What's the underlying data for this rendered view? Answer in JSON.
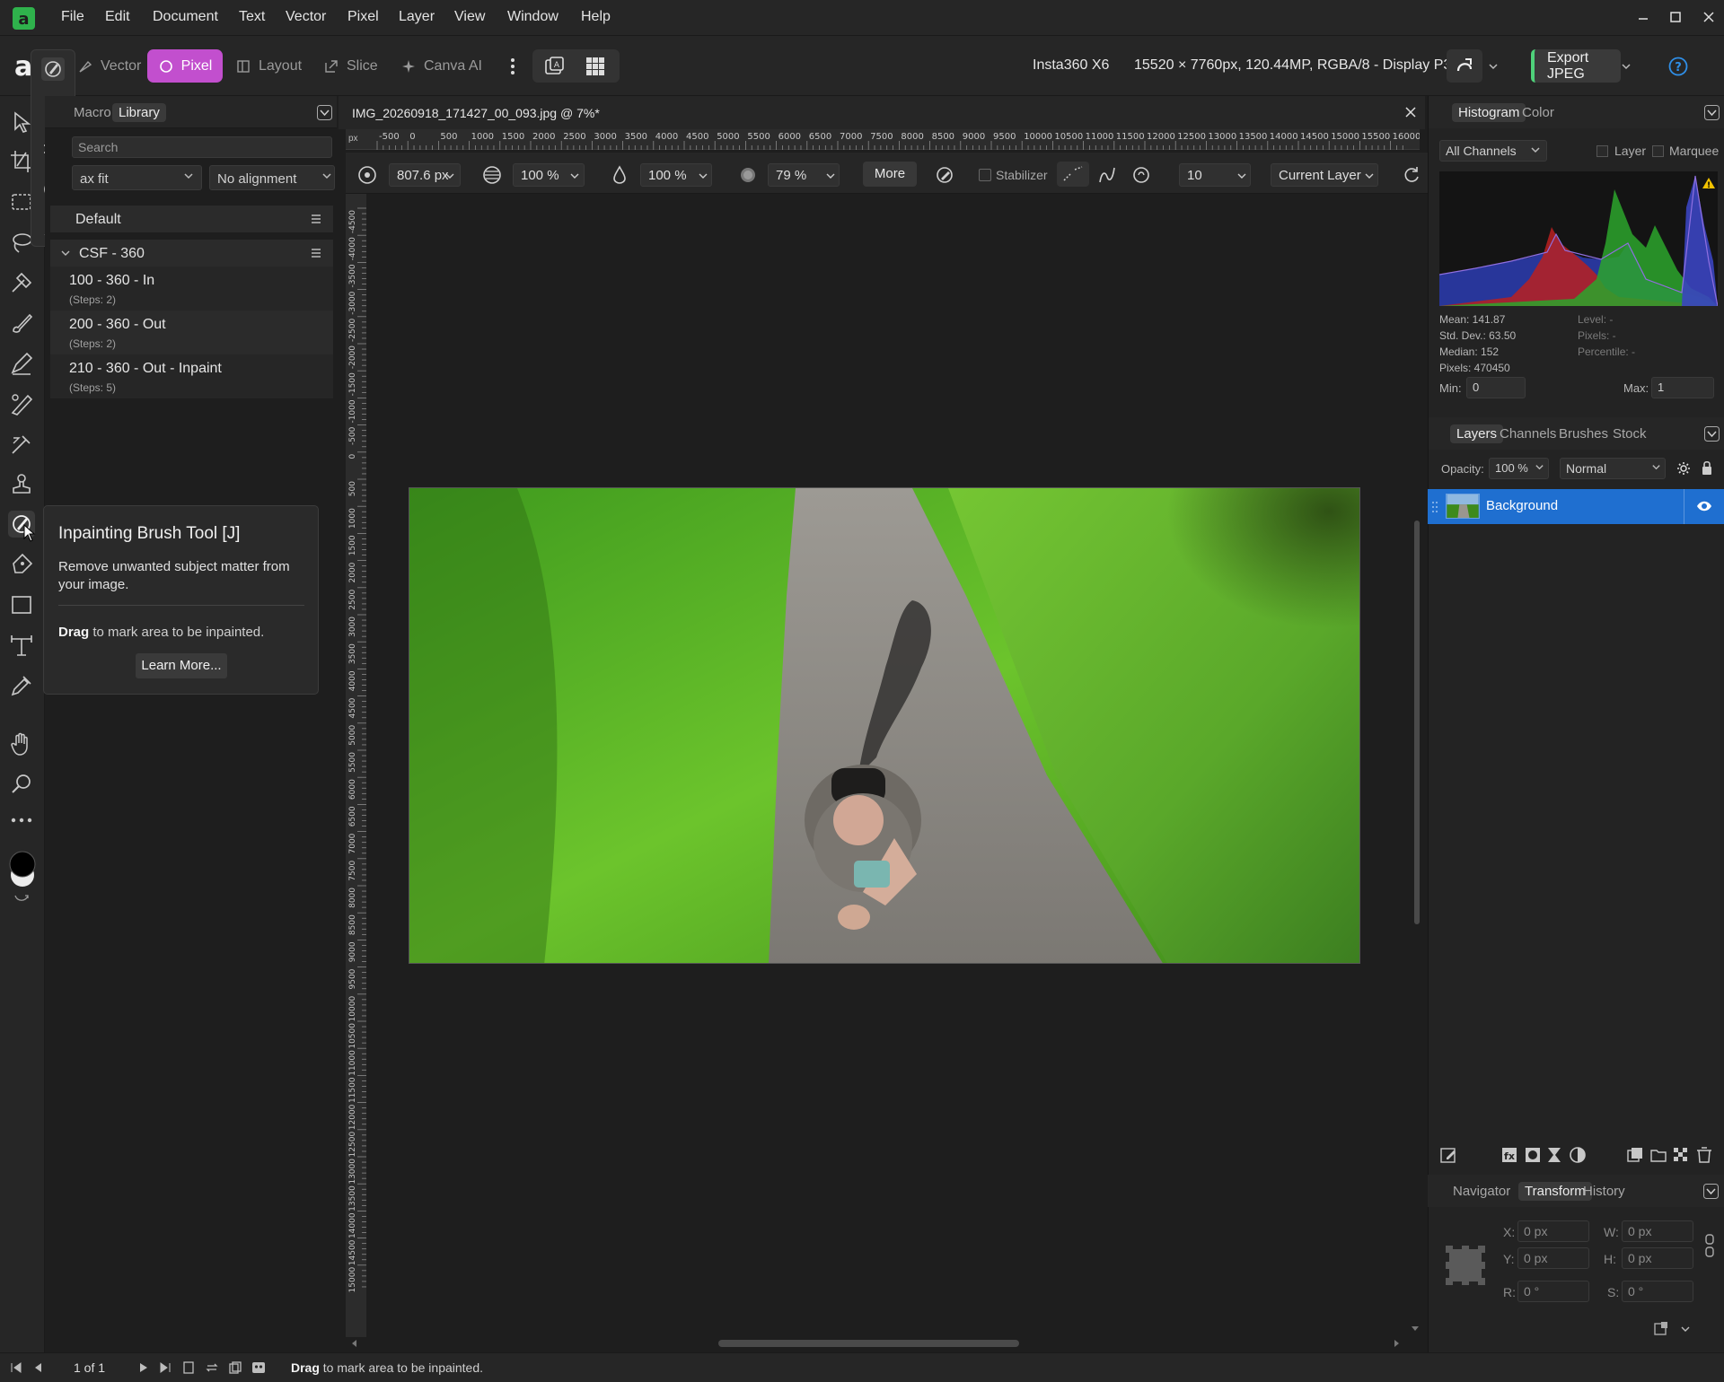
{
  "menubar": {
    "items": [
      "File",
      "Edit",
      "Document",
      "Text",
      "Vector",
      "Pixel",
      "Layer",
      "View",
      "Window",
      "Help"
    ]
  },
  "toolbar": {
    "personas": [
      "Vector",
      "Pixel",
      "Layout",
      "Slice",
      "Canva AI"
    ],
    "active_persona": "Pixel",
    "camera": "Insta360 X6",
    "doc_info": "15520 × 7760px, 120.44MP, RGBA/8 - Display P3",
    "export_label": "Export JPEG"
  },
  "library": {
    "tabs": [
      "Macro",
      "Library"
    ],
    "search_placeholder": "Search",
    "fit_select": "ax fit",
    "alignment_select": "No alignment",
    "groups": [
      {
        "name": "Default"
      },
      {
        "name": "CSF - 360"
      }
    ],
    "macros": [
      {
        "name": "100 - 360 - In",
        "steps": "(Steps: 2)"
      },
      {
        "name": "200 - 360 - Out",
        "steps": "(Steps: 2)"
      },
      {
        "name": "210 - 360 - Out - Inpaint",
        "steps": "(Steps: 5)"
      }
    ]
  },
  "tooltip": {
    "title": "Inpainting Brush Tool [J]",
    "description": "Remove unwanted subject matter from your image.",
    "drag_bold": "Drag",
    "drag_text": " to mark area to be inpainted.",
    "learn_more": "Learn More..."
  },
  "document": {
    "tab_title": "IMG_20260918_171427_00_093.jpg @ 7%*",
    "ruler_unit": "px",
    "hruler_ticks": [
      "-500",
      "0",
      "500",
      "1000",
      "1500",
      "2000",
      "2500",
      "3000",
      "3500",
      "4000",
      "4500",
      "5000",
      "5500",
      "6000",
      "6500",
      "7000",
      "7500",
      "8000",
      "8500",
      "9000",
      "9500",
      "10000",
      "10500",
      "11000",
      "11500",
      "12000",
      "12500",
      "13000",
      "13500",
      "14000",
      "14500",
      "15000",
      "15500",
      "16000"
    ],
    "vruler_ticks": [
      "-4500",
      "-4000",
      "-3500",
      "-3000",
      "-2500",
      "-2000",
      "-1500",
      "-1000",
      "-500",
      "0",
      "500",
      "1000",
      "1500",
      "2000",
      "2500",
      "3000",
      "3500",
      "4000",
      "4500",
      "5000",
      "5500",
      "6000",
      "6500",
      "7000",
      "7500",
      "8000",
      "8500",
      "9000",
      "9500",
      "10000",
      "10500",
      "11000",
      "11500",
      "12000",
      "12500",
      "13000",
      "13500",
      "14000",
      "14500",
      "15000"
    ]
  },
  "context": {
    "width": "807.6 px",
    "opacity": "100 %",
    "flow": "100 %",
    "hardness": "79 %",
    "more": "More",
    "stabilizer": "Stabilizer",
    "stab_value": "10",
    "source": "Current Layer"
  },
  "histogram": {
    "tabs": [
      "Histogram",
      "Color"
    ],
    "channel": "All Channels",
    "layer_label": "Layer",
    "marquee_label": "Marquee",
    "mean": "Mean: 141.87",
    "std": "Std. Dev.: 63.50",
    "median": "Median: 152",
    "pixels": "Pixels: 470450",
    "level": "Level: -",
    "pixels_r": "Pixels: -",
    "percentile": "Percentile: -",
    "min_label": "Min:",
    "min_value": "0",
    "max_label": "Max:",
    "max_value": "1"
  },
  "layers": {
    "tabs": [
      "Layers",
      "Channels",
      "Brushes",
      "Stock"
    ],
    "opacity_label": "Opacity:",
    "opacity_value": "100 %",
    "blend_mode": "Normal",
    "layer_name": "Background"
  },
  "transform": {
    "tabs": [
      "Navigator",
      "Transform",
      "History"
    ],
    "x_label": "X:",
    "x_value": "0 px",
    "y_label": "Y:",
    "y_value": "0 px",
    "w_label": "W:",
    "w_value": "0 px",
    "h_label": "H:",
    "h_value": "0 px",
    "r_label": "R:",
    "r_value": "0 °",
    "s_label": "S:",
    "s_value": "0 °"
  },
  "statusbar": {
    "page": "1 of 1",
    "hint_bold": "Drag",
    "hint_text": " to mark area to be inpainted."
  }
}
